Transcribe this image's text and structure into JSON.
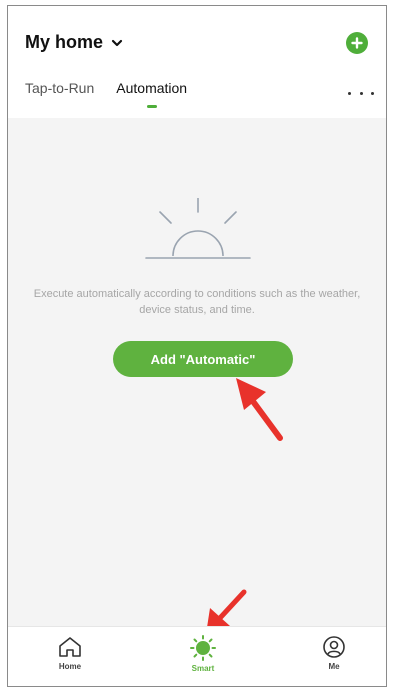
{
  "header": {
    "home_title": "My home",
    "tabs": [
      {
        "label": "Tap-to-Run",
        "active": false
      },
      {
        "label": "Automation",
        "active": true
      }
    ]
  },
  "empty_state": {
    "description": "Execute automatically according to conditions such as the weather, device status, and time.",
    "add_button_label": "Add \"Automatic\""
  },
  "bottom_nav": {
    "items": [
      {
        "label": "Home",
        "icon": "home-icon",
        "active": false
      },
      {
        "label": "Smart",
        "icon": "smart-sun-icon",
        "active": true
      },
      {
        "label": "Me",
        "icon": "profile-icon",
        "active": false
      }
    ]
  },
  "colors": {
    "accent": "#5fb23f",
    "annotation_arrow": "#e8322b"
  },
  "icons": {
    "header_add": "plus-circle-icon",
    "header_more": "more-dots-icon",
    "home_dropdown": "chevron-down-icon",
    "illustration": "sunrise-icon"
  }
}
